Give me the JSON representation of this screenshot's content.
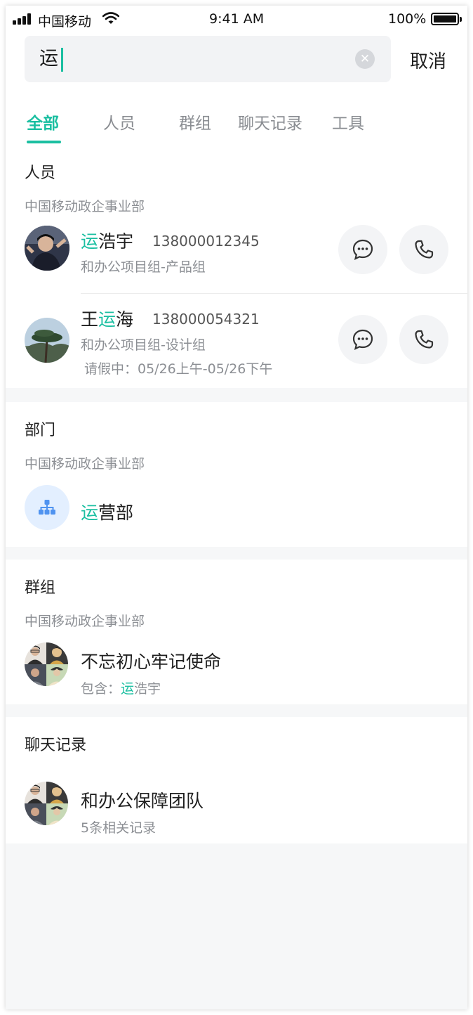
{
  "status_bar": {
    "carrier": "中国移动",
    "time": "9:41 AM",
    "battery": "100%"
  },
  "search": {
    "query": "运",
    "clear_icon": "clear-icon",
    "cancel_label": "取消"
  },
  "tabs": [
    {
      "label": "全部",
      "active": true
    },
    {
      "label": "人员"
    },
    {
      "label": "群组"
    },
    {
      "label": "聊天记录"
    },
    {
      "label": "工具"
    }
  ],
  "people": {
    "title": "人员",
    "org": "中国移动政企事业部",
    "items": [
      {
        "name_hl": "运",
        "name_rest": "浩宇",
        "phone": "138000012345",
        "dept": "和办公项目组-产品组"
      },
      {
        "name_pre": "王",
        "name_hl": "运",
        "name_rest": "海",
        "phone": "138000054321",
        "dept": "和办公项目组-设计组",
        "leave": "请假中：05/26上午-05/26下午"
      }
    ]
  },
  "departments": {
    "title": "部门",
    "org": "中国移动政企事业部",
    "item": {
      "name_hl": "运",
      "name_rest": "营部"
    }
  },
  "groups": {
    "title": "群组",
    "org": "中国移动政企事业部",
    "item": {
      "name": "不忘初心牢记使命",
      "contains_label": "包含：",
      "contains_hl": "运",
      "contains_rest": "浩宇"
    }
  },
  "chats": {
    "title": "聊天记录",
    "item": {
      "name": "和办公保障团队",
      "count_text": "5条相关记录"
    }
  },
  "colors": {
    "accent": "#1bbfa1",
    "dept_icon_bg": "#e3efff",
    "dept_icon": "#4f93f0"
  }
}
